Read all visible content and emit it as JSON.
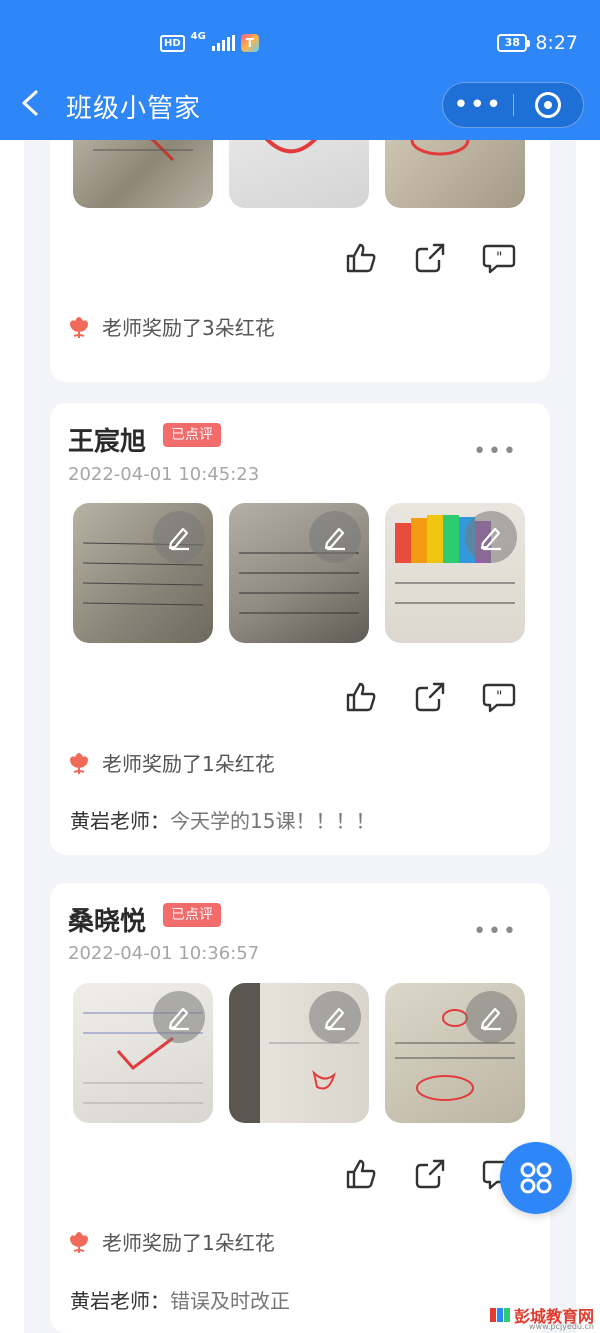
{
  "status_bar": {
    "hd": "HD",
    "network": "4G",
    "battery": "38",
    "time": "8:27"
  },
  "nav": {
    "title": "班级小管家",
    "more_dots": "•••"
  },
  "colors": {
    "primary": "#2f86f6",
    "badge": "#f36c6c",
    "reward_flower": "#f06a5a"
  },
  "cards": [
    {
      "reward": "老师奖励了3朵红花"
    },
    {
      "name": "王宸旭",
      "badge": "已点评",
      "time": "2022-04-01 10:45:23",
      "reward": "老师奖励了1朵红花",
      "commenter": "黄岩老师：",
      "comment": "今天学的15课！！！！"
    },
    {
      "name": "桑晓悦",
      "badge": "已点评",
      "time": "2022-04-01 10:36:57",
      "reward": "老师奖励了1朵红花",
      "commenter": "黄岩老师：",
      "comment": "错误及时改正"
    }
  ],
  "icons": [
    "back-icon",
    "more-icon",
    "target-icon",
    "edit-icon",
    "like-icon",
    "share-icon",
    "comment-icon",
    "flower-icon",
    "menu-grid-icon"
  ],
  "watermark": {
    "text": "彭城教育网",
    "url": "www.pcjyedu.cn"
  }
}
